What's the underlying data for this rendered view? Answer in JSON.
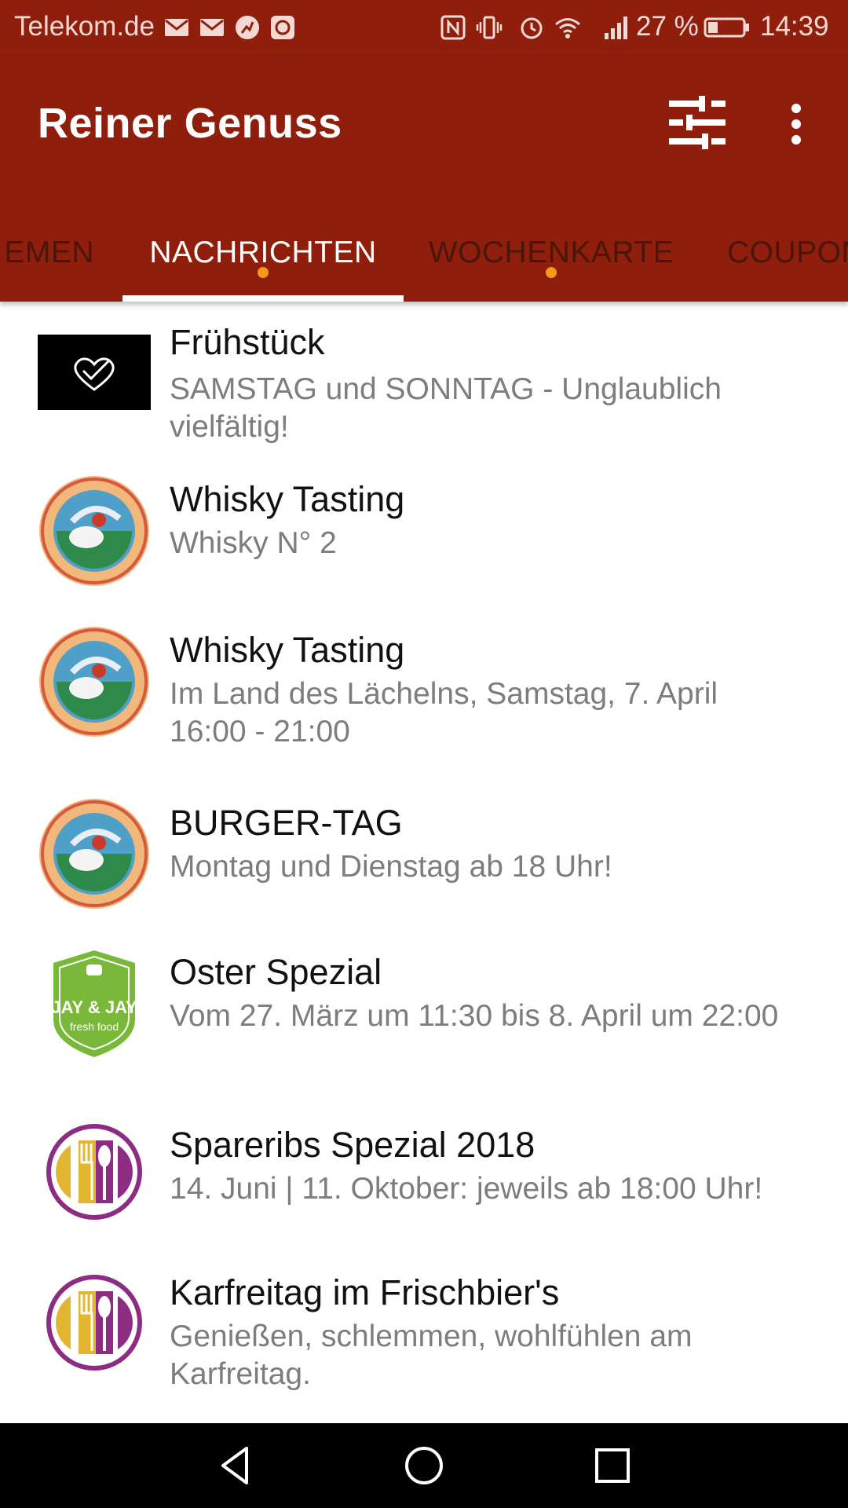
{
  "status_bar": {
    "carrier": "Telekom.de",
    "battery_percent": "27 %",
    "time": "14:39",
    "left_icons": [
      "mail-icon",
      "mail-icon",
      "sport-app-icon",
      "app-icon"
    ],
    "right_icons": [
      "nfc-icon",
      "vibrate-icon",
      "alarm-icon",
      "wifi-icon",
      "signal-icon",
      "battery-icon"
    ]
  },
  "app_bar": {
    "title": "Reiner Genuss",
    "actions": [
      "filter-icon",
      "more-vert-icon"
    ]
  },
  "tabs": [
    {
      "label": "THEMEN",
      "visible_text": "EMEN",
      "active": false,
      "dot": false
    },
    {
      "label": "NACHRICHTEN",
      "visible_text": "NACHRICHTEN",
      "active": true,
      "dot": true
    },
    {
      "label": "WOCHENKARTE",
      "visible_text": "WOCHENKARTE",
      "active": false,
      "dot": true
    },
    {
      "label": "COUPONS",
      "visible_text": "COUPON",
      "active": false,
      "dot": false
    }
  ],
  "items": [
    {
      "title": "Frühstück",
      "subtitle": "SAMSTAG und SONNTAG - Unglaublich vielfältig!",
      "logo": "heart-logo"
    },
    {
      "title": "Whisky Tasting",
      "subtitle": "Whisky N° 2",
      "logo": "zur-wilden-ente-logo"
    },
    {
      "title": "Whisky Tasting",
      "subtitle": "Im Land des Lächelns, Samstag, 7. April 16:00 - 21:00",
      "logo": "zur-wilden-ente-logo"
    },
    {
      "title": "BURGER-TAG",
      "subtitle": "Montag und Dienstag ab 18 Uhr!",
      "logo": "zur-wilden-ente-logo"
    },
    {
      "title": "Oster Spezial",
      "subtitle": "Vom 27. März um 11:30 bis 8. April um 22:00",
      "logo": "jay-and-jay-logo",
      "logo_text": [
        "JAY & JAY",
        "fresh food"
      ]
    },
    {
      "title": "Spareribs Spezial 2018",
      "subtitle": "14. Juni | 11. Oktober: jeweils ab 18:00 Uhr!",
      "logo": "fork-spoon-knife-logo"
    },
    {
      "title": "Karfreitag im Frischbier's",
      "subtitle": "Genießen, schlemmen, wohlfühlen am Karfreitag.",
      "logo": "fork-spoon-knife-logo"
    }
  ],
  "colors": {
    "primary": "#8f1e0c",
    "tab_inactive": "#4a160b",
    "badge_dot": "#f39a1c",
    "subtitle_text": "#7d7d7d"
  },
  "nav_bar": [
    "back-icon",
    "home-icon",
    "recents-icon"
  ]
}
